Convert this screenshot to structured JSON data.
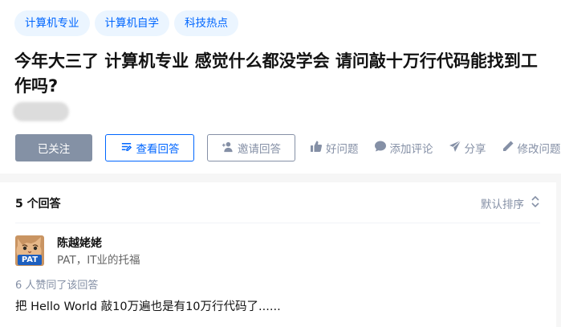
{
  "question": {
    "tags": [
      "计算机专业",
      "计算机自学",
      "科技热点"
    ],
    "title": "今年大三了 计算机专业 感觉什么都没学会 请问敲十万行代码能找到工作吗?"
  },
  "actions": {
    "followed": "已关注",
    "view_answers": "查看回答",
    "invite_answer": "邀请回答",
    "good_question": "好问题",
    "add_comment": "添加评论",
    "share": "分享",
    "edit_question": "修改问题"
  },
  "answers": {
    "count_label": "5 个回答",
    "sort_label": "默认排序",
    "items": [
      {
        "author_name": "陈越姥姥",
        "author_bio": "PAT，IT业的托福",
        "avatar_text": "PAT",
        "votes": "6 人赞同了该回答",
        "excerpt": "把 Hello World 敲10万遍也是有10万行代码了......"
      }
    ]
  },
  "colors": {
    "primary": "#0066ff",
    "tag_bg": "#ebf5ff",
    "followed_bg": "#8491a5",
    "muted": "#8590a6"
  }
}
